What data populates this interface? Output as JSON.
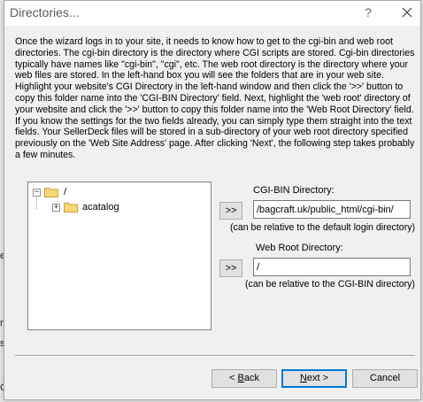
{
  "background_glyphs": [
    "e",
    "m",
    "sh",
    "C"
  ],
  "dialog": {
    "title": "Directories...",
    "help_glyph": "?",
    "intro_text": "Once the wizard logs in to your site, it needs to know how to get to the cgi-bin and web root directories. The cgi-bin directory is the directory where CGI scripts are stored. Cgi-bin directories typically have names like \"cgi-bin\", \"cgi\", etc. The web root directory is the directory where your web files are stored. In the left-hand box you will see the folders that are in your web site. Highlight your website's CGI Directory in the left-hand window and then click the '>>' button to copy this folder name into the 'CGI-BIN Directory' field. Next, highlight the 'web root' directory of your website and click the '>>' button to copy this folder name into the 'Web Root Directory' field. If you know the settings for the two fields already, you can simply type them straight into the text fields. Your SellerDeck files will be stored in a sub-directory of your web root directory specified previously on the 'Web Site Address' page. After clicking 'Next', the following step takes probably a few minutes."
  },
  "tree": {
    "root": {
      "label": "/",
      "expander": "−"
    },
    "children": [
      {
        "label": "acatalog",
        "expander": "+"
      }
    ]
  },
  "cgi": {
    "label": "CGI-BIN Directory:",
    "copy_button": ">>",
    "value": "/bagcraft.uk/public_html/cgi-bin/",
    "hint": "(can be relative to the default login directory)"
  },
  "webroot": {
    "label": "Web Root Directory:",
    "copy_button": ">>",
    "value": "/",
    "hint": "(can be relative to the CGI-BIN directory)"
  },
  "buttons": {
    "back": {
      "prefix": "< ",
      "mnemonic": "B",
      "rest": "ack"
    },
    "next": {
      "mnemonic": "N",
      "rest": "ext >"
    },
    "cancel": "Cancel"
  },
  "colors": {
    "dialog_bg": "#f0f0f0",
    "folder_yellow": "#f8d775",
    "default_button_border": "#0078d7"
  }
}
